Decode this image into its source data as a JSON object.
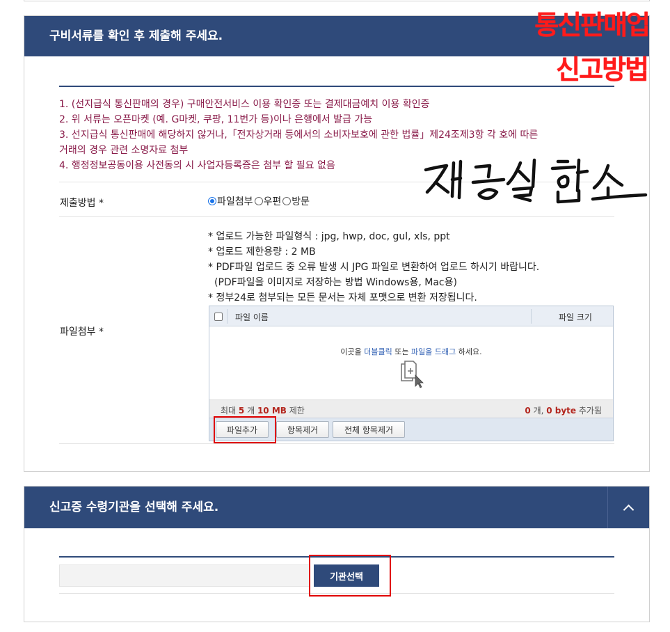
{
  "section1": {
    "title": "구비서류를 확인 후 제출해 주세요.",
    "overlay_line1": "통신판매업",
    "overlay_line2": "신고방법",
    "notes": [
      "1. (선지급식 통신판매의 경우) 구매안전서비스 이용 확인증 또는 결제대금예치 이용 확인증",
      "2. 위 서류는 오픈마켓 (예. G마켓, 쿠팡, 11번가 등)이나 은행에서 발급 가능",
      "3. 선지급식 통신판매에 해당하지 않거나,「전자상거래 등에서의 소비자보호에 관한 법률」제24조제3항 각 호에 따른",
      "거래의 경우 관련 소명자료 첨부",
      "4. 행정정보공동이용 사전동의 시 사업자등록증은 첨부 할 필요 없음"
    ],
    "submit_method_label": "제출방법 *",
    "submit_options": [
      "파일첨부",
      "우편",
      "방문"
    ],
    "selected_option": "파일첨부",
    "attach_label": "파일첨부 *",
    "file_info": [
      "* 업로드 가능한 파일형식 : jpg, hwp, doc, gul, xls, ppt",
      "* 업로드 제한용량 : 2 MB",
      "* PDF파일 업로드 중 오류 발생 시 JPG 파일로 변환하여 업로드 하시기 바랍니다.",
      "(PDF파일을 이미지로 저장하는 방법  Windows용, Mac용)",
      "* 정부24로 첨부되는 모든 문서는 자체 포맷으로 변환 저장됩니다."
    ],
    "signature_text": "재능실험소"
  },
  "uploader": {
    "col_name": "파일 이름",
    "col_size": "파일 크기",
    "drop_prefix": "이곳을 ",
    "drop_hl1": "더블클릭",
    "drop_mid": " 또는 ",
    "drop_hl2": "파일을 드래그",
    "drop_suffix": " 하세요.",
    "limit_prefix": "최대 ",
    "limit_count": "5",
    "limit_mid": " 개 ",
    "limit_size": "10 MB",
    "limit_suffix": " 제한",
    "added_count": "0",
    "added_mid": " 개, ",
    "added_size": "0 byte",
    "added_suffix": " 추가됨",
    "btn_add": "파일추가",
    "btn_remove": "항목제거",
    "btn_remove_all": "전체 항목제거"
  },
  "section2": {
    "title": "신고증 수령기관을 선택해 주세요.",
    "agency_button": "기관선택"
  },
  "colors": {
    "header_navy": "#2f4a7a",
    "note_text": "#8a1c4a",
    "overlay_red": "#ff1b1b",
    "highlight_box": "#e00000"
  }
}
